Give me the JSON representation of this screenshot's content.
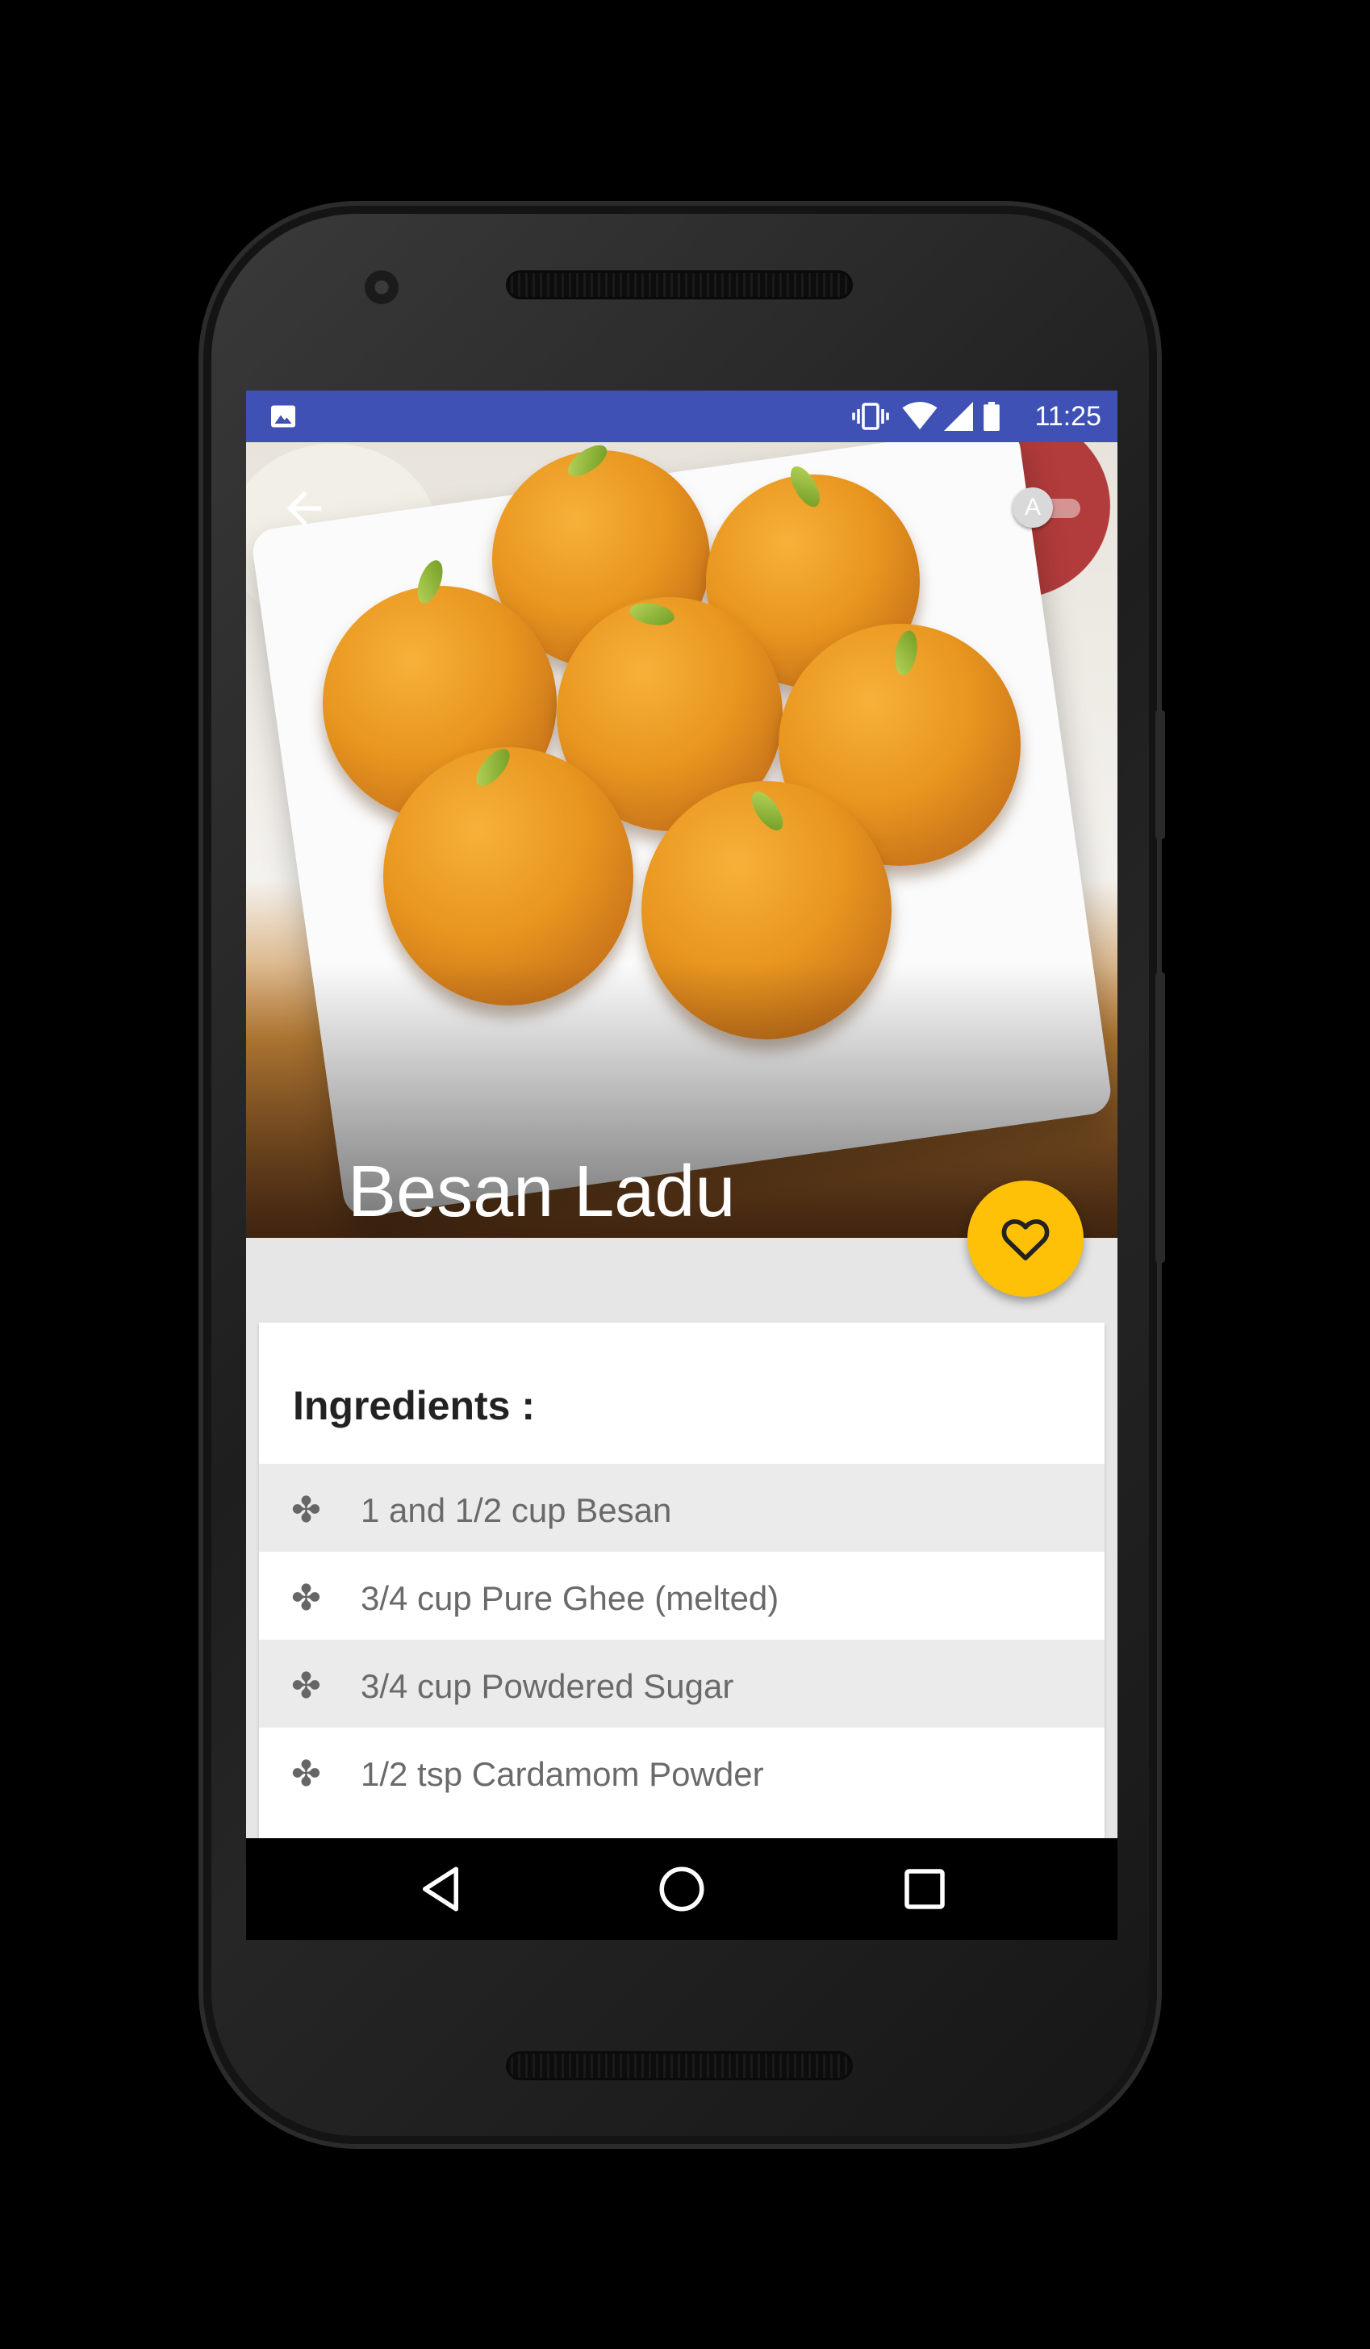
{
  "status_bar": {
    "time": "11:25",
    "icons": [
      "image-notification-icon",
      "vibrate-icon",
      "wifi-icon",
      "signal-icon",
      "battery-icon"
    ],
    "background_color": "#3f51b5"
  },
  "recipe": {
    "title": "Besan Ladu",
    "toggle_label": "A",
    "favorite_icon": "heart-outline-icon",
    "fab_color": "#ffc107"
  },
  "ingredients": {
    "heading": "Ingredients :",
    "bullet": "✤",
    "items": [
      "1 and 1/2 cup Besan",
      "3/4 cup Pure Ghee (melted)",
      "3/4 cup Powdered Sugar",
      "1/2 tsp Cardamom Powder"
    ]
  },
  "navigation": {
    "back_icon": "triangle-back-icon",
    "home_icon": "circle-home-icon",
    "recents_icon": "square-recents-icon"
  }
}
